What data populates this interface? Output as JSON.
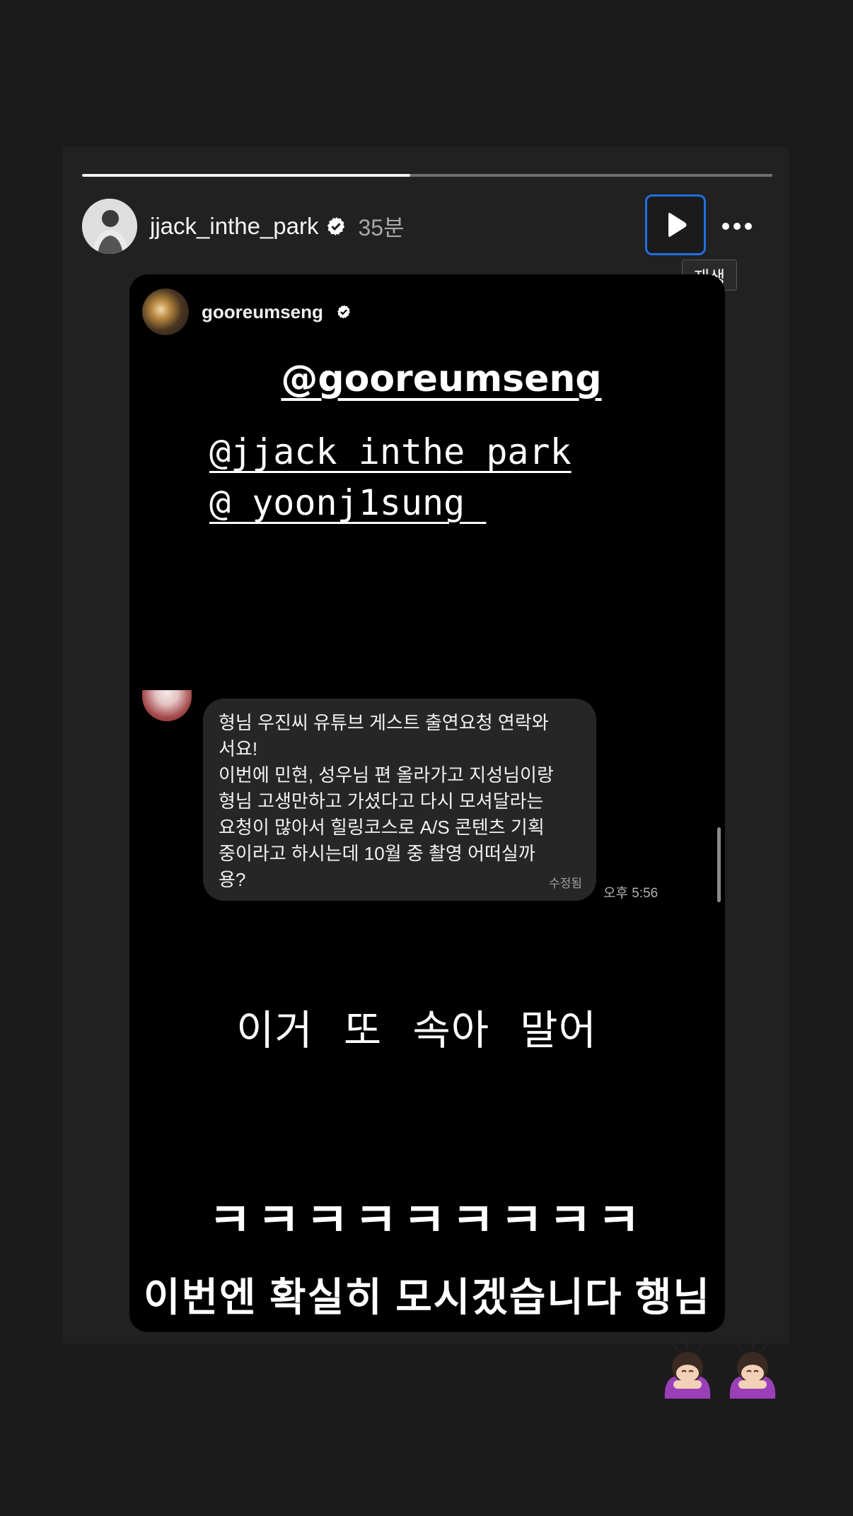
{
  "progress": {
    "fraction": 0.475
  },
  "header": {
    "username": "jjack_inthe_park",
    "time_ago": "35분",
    "tooltip": "재생"
  },
  "icons": {
    "avatar": "profile-photo",
    "verified": "verified-badge-icon",
    "play": "play-icon",
    "more": "more-options-icon"
  },
  "card": {
    "username": "gooreumseng",
    "mention_main": "@gooreumseng",
    "mention_1": "@jjack_inthe_park",
    "mention_2": "@_yoonj1sung_"
  },
  "dm": {
    "message": "형님 우진씨 유튜브 게스트 출연요청 연락와\n서요!\n이번에 민현, 성우님 편 올라가고 지성님이랑\n형님 고생만하고 가셨다고 다시 모셔달라는\n요청이 많아서 힐링코스로 A/S 콘텐츠 기획\n중이라고 하시는데 10월 중 촬영 어떠실까\n용?",
    "edited": "수정됨",
    "time": "오후 5:56"
  },
  "captions": {
    "line1": "이거 또 속아 말어",
    "line2": "ㅋㅋㅋㅋㅋㅋㅋㅋㅋ",
    "line3": "이번엔 확실히 모시겠습니다 행님"
  },
  "emoji": [
    "🙇‍♀️",
    "🙇‍♀️"
  ],
  "colors": {
    "background": "#1b1b1b",
    "focus_ring": "#1f6fe0",
    "verified": "#ffffff"
  }
}
